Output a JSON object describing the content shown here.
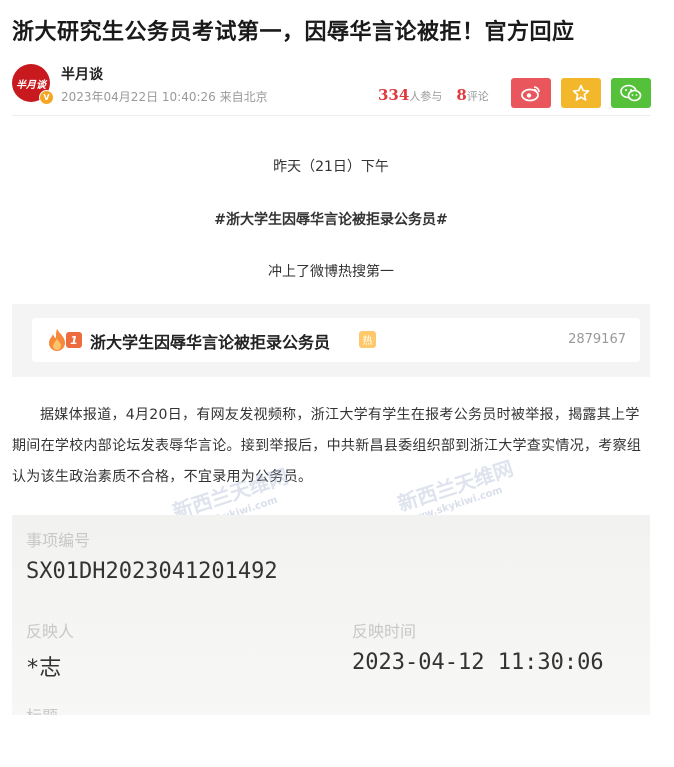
{
  "article": {
    "title": "浙大研究生公务员考试第一，因辱华言论被拒！官方回应"
  },
  "author": {
    "avatar_text": "半月谈",
    "verified_mark": "V",
    "name": "半月谈",
    "meta": "2023年04月22日 10:40:26 来自北京"
  },
  "stats": {
    "participants": "334",
    "participants_label": "人参与",
    "comments": "8",
    "comments_label": "评论"
  },
  "share_icons": [
    "weibo-icon",
    "star-icon",
    "wechat-icon"
  ],
  "body": {
    "line1": "昨天（21日）下午",
    "hashtag": "#浙大学生因辱华言论被拒录公务员#",
    "line3": "冲上了微博热搜第一",
    "hot_search": {
      "rank": "1",
      "title": "浙大学生因辱华言论被拒录公务员",
      "badge": "热",
      "count": "2879167"
    },
    "paragraph": "据媒体报道，4月20日，有网友发视频称，浙江大学有学生在报考公务员时被举报，揭露其上学期间在学校内部论坛发表辱华言论。接到举报后，中共新昌县委组织部到浙江大学查实情况，考察组认为该生政治素质不合格，不宜录用为公务员。"
  },
  "watermarks": [
    "新西兰天维网",
    "www.skykiwi.com",
    "新西兰天维网",
    "www.skykiwi.com"
  ],
  "screenshot": {
    "field1_label": "事项编号",
    "field1_value": "SX01DH2023041201492",
    "field2_label": "反映人",
    "field2_value": "*志",
    "field3_label": "反映时间",
    "field3_value": "2023-04-12 11:30:06",
    "field4_label": "标题"
  },
  "colors": {
    "weibo": "#e9575c",
    "favorite": "#f3b72c",
    "wechat": "#55c03a",
    "accent_red": "#e0393e"
  }
}
